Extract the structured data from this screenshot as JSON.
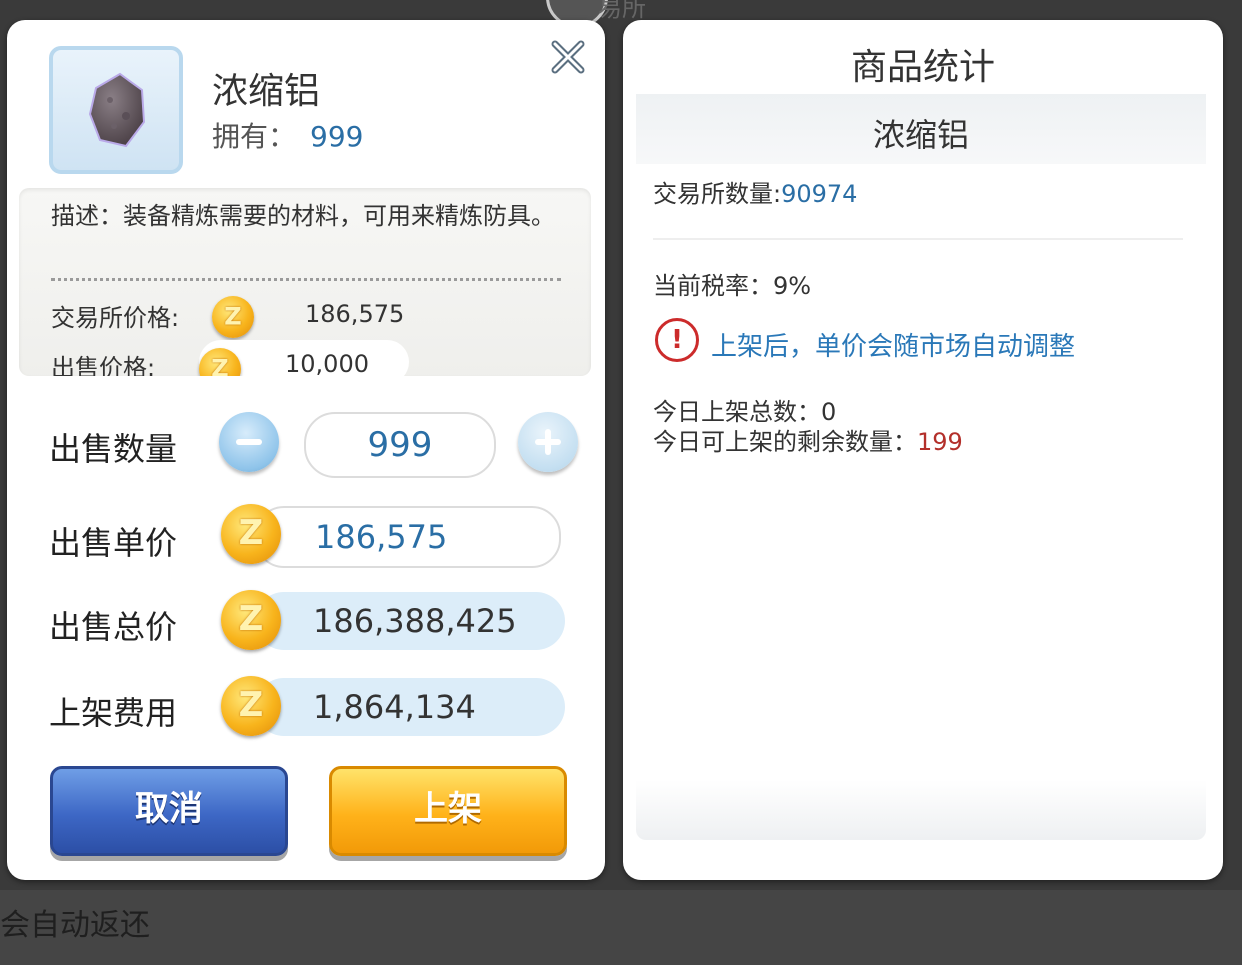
{
  "item": {
    "name": "浓缩铝",
    "owned_label": "拥有：",
    "owned_value": "999",
    "description": "描述：装备精炼需要的材料，可用来精炼防具。",
    "exchange_price_label": "交易所价格:",
    "exchange_price_value": "186,575",
    "sell_price_label": "出售价格:",
    "sell_price_value": "10,000"
  },
  "form": {
    "quantity_label": "出售数量",
    "quantity_value": "999",
    "unit_price_label": "出售单价",
    "unit_price_value": "186,575",
    "total_price_label": "出售总价",
    "total_price_value": "186,388,425",
    "fee_label": "上架费用",
    "fee_value": "1,864,134"
  },
  "buttons": {
    "cancel": "取消",
    "list": "上架"
  },
  "stats": {
    "title": "商品统计",
    "item_name": "浓缩铝",
    "exchange_qty_label": "交易所数量:",
    "exchange_qty_value": "90974",
    "tax_label": "当前税率：",
    "tax_value": "9%",
    "warning": "上架后，单价会随市场自动调整",
    "today_listed_label": "今日上架总数：",
    "today_listed_value": "0",
    "remaining_label": "今日可上架的剩余数量：",
    "remaining_value": "199"
  },
  "background": {
    "bottom_text": "会自动返还",
    "top_text": "易所"
  },
  "colors": {
    "accent_blue": "#2a6ea5",
    "warning_red": "#cc2b2b",
    "remaining_red": "#b3302b",
    "cancel_button": "#3d67c5",
    "list_button": "#ffb21a",
    "coin_gold": "#f8b41c"
  },
  "icons": {
    "close": "close-icon",
    "coin": "zeny-coin-icon",
    "minus": "minus-icon",
    "plus": "plus-icon",
    "warning": "exclamation-icon",
    "item": "aluminum-ore-icon"
  }
}
